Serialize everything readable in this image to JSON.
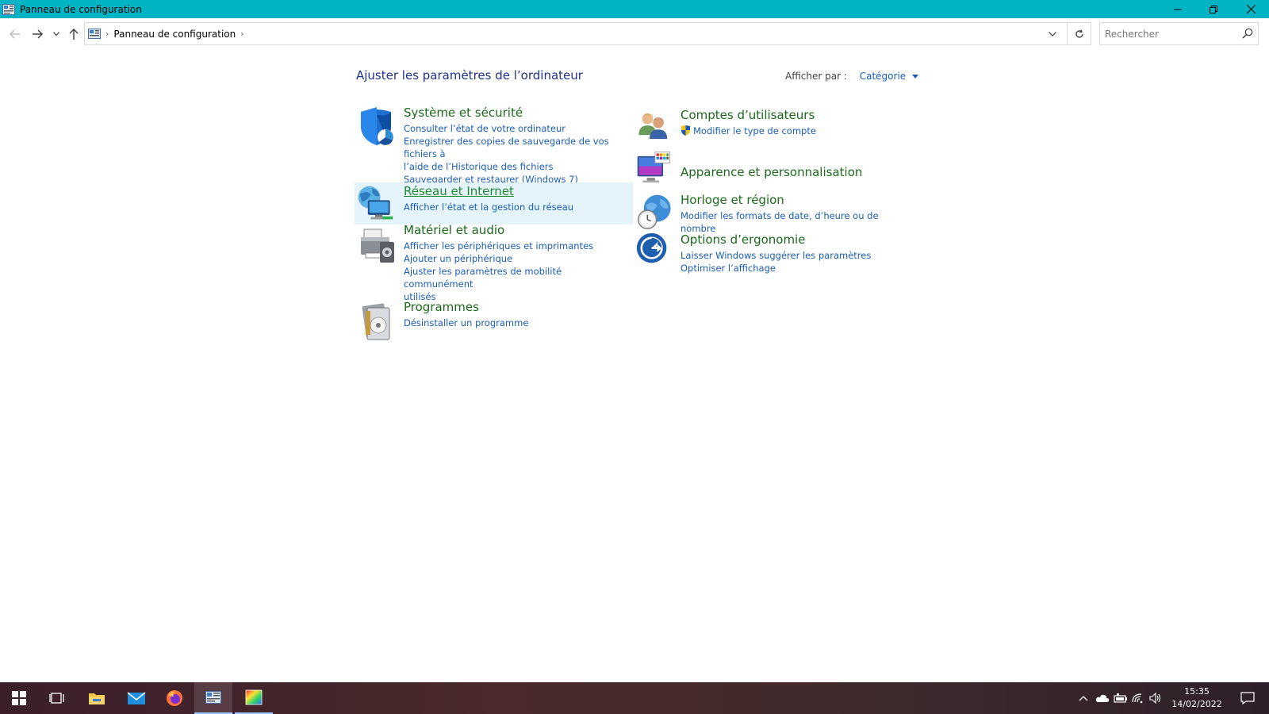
{
  "window": {
    "title": "Panneau de configuration"
  },
  "address": {
    "breadcrumb": "Panneau de configuration",
    "search_placeholder": "Rechercher"
  },
  "main": {
    "heading": "Ajuster les paramètres de l’ordinateur",
    "view_by_label": "Afficher par :",
    "view_by_value": "Catégorie"
  },
  "categories": {
    "system": {
      "title": "Système et sécurité",
      "links": [
        "Consulter l’état de votre ordinateur",
        "Enregistrer des copies de sauvegarde de vos fichiers à",
        "l’aide de l’Historique des fichiers",
        "Sauvegarder et restaurer (Windows 7)"
      ]
    },
    "network": {
      "title": "Réseau et Internet",
      "links": [
        "Afficher l’état et la gestion du réseau"
      ]
    },
    "hardware": {
      "title": "Matériel et audio",
      "links": [
        "Afficher les périphériques et imprimantes",
        "Ajouter un périphérique",
        "Ajuster les paramètres de mobilité communément",
        "utilisés"
      ]
    },
    "programs": {
      "title": "Programmes",
      "links": [
        "Désinstaller un programme"
      ]
    },
    "accounts": {
      "title": "Comptes d’utilisateurs",
      "links": [
        "Modifier le type de compte"
      ]
    },
    "appearance": {
      "title": "Apparence et personnalisation",
      "links": []
    },
    "clock": {
      "title": "Horloge et région",
      "links": [
        "Modifier les formats de date, d’heure ou de nombre"
      ]
    },
    "ease": {
      "title": "Options d’ergonomie",
      "links": [
        "Laisser Windows suggérer les paramètres",
        "Optimiser l’affichage"
      ]
    }
  },
  "taskbar": {
    "time": "15:35",
    "date": "14/02/2022"
  },
  "colors": {
    "titlebar": "#00b4c3",
    "category_title": "#1a6a1a",
    "link": "#1a5fb4",
    "hover_bg": "#e5f3fb"
  }
}
